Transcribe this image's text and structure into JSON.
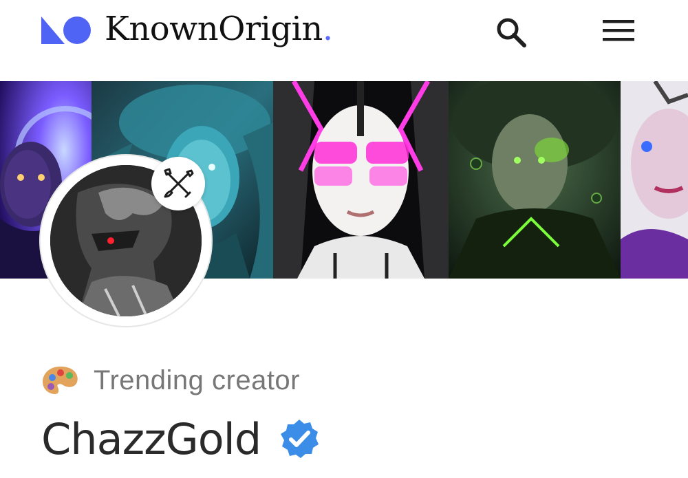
{
  "header": {
    "brand_name": "KnownOrigin",
    "brand_dot": ".",
    "logo_icon": "knownorigin-logo-icon",
    "search_icon": "search-icon",
    "menu_icon": "hamburger-menu-icon",
    "brand_accent_color": "#5a6bff"
  },
  "banner": {
    "panels": [
      {
        "name": "banner-artwork-1"
      },
      {
        "name": "banner-artwork-2"
      },
      {
        "name": "banner-artwork-3"
      },
      {
        "name": "banner-artwork-4"
      },
      {
        "name": "banner-artwork-5"
      }
    ]
  },
  "profile": {
    "avatar_icon": "avatar",
    "badge_icon": "artist-brush-badge-icon",
    "trending_icon": "palette-icon",
    "trending_label": "Trending creator",
    "creator_name": "ChazzGold",
    "verified_icon": "verified-badge-icon",
    "verified_color": "#3b8de8"
  }
}
